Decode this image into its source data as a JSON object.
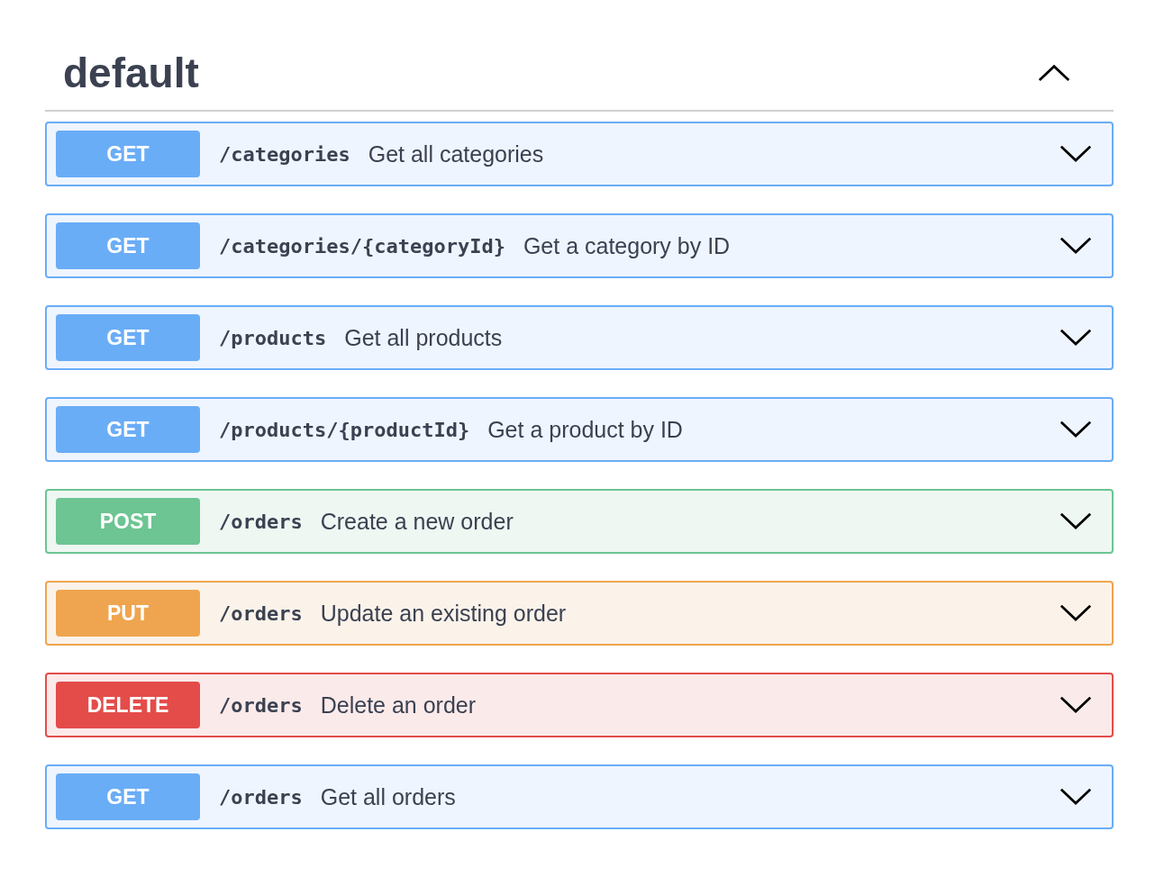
{
  "section": {
    "title": "default",
    "expanded": true
  },
  "operations": [
    {
      "kind": "get",
      "method": "GET",
      "path": "/categories",
      "summary": "Get all categories",
      "expanded": false
    },
    {
      "kind": "get",
      "method": "GET",
      "path": "/categories/{categoryId}",
      "summary": "Get a category by ID",
      "expanded": false
    },
    {
      "kind": "get",
      "method": "GET",
      "path": "/products",
      "summary": "Get all products",
      "expanded": false
    },
    {
      "kind": "get",
      "method": "GET",
      "path": "/products/{productId}",
      "summary": "Get a product by ID",
      "expanded": false
    },
    {
      "kind": "post",
      "method": "POST",
      "path": "/orders",
      "summary": "Create a new order",
      "expanded": false
    },
    {
      "kind": "put",
      "method": "PUT",
      "path": "/orders",
      "summary": "Update an existing order",
      "expanded": false
    },
    {
      "kind": "delete",
      "method": "DELETE",
      "path": "/orders",
      "summary": "Delete an order",
      "expanded": false
    },
    {
      "kind": "get",
      "method": "GET",
      "path": "/orders",
      "summary": "Get all orders",
      "expanded": false
    }
  ]
}
